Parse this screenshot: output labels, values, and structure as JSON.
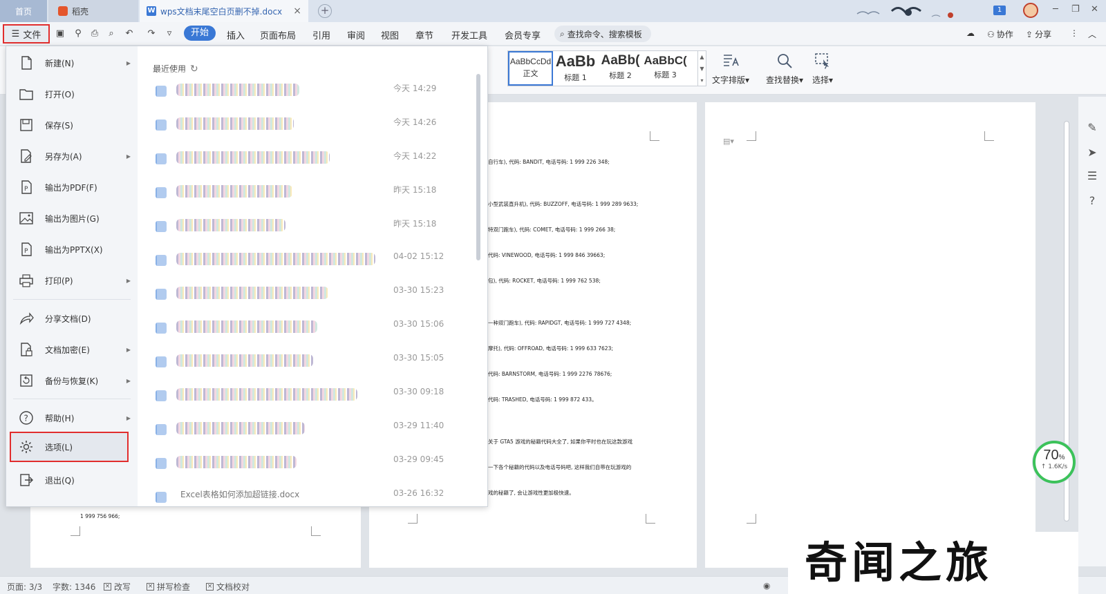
{
  "titlebar": {
    "home_tab": "首页",
    "docer_tab": "稻壳",
    "doc_tab": "wps文档末尾空白页删不掉.docx",
    "close_glyph": "×",
    "plus_glyph": "+",
    "badge": "1",
    "window_controls": [
      "─",
      "❐",
      "✕"
    ]
  },
  "menubar": {
    "file_label": "文件",
    "tabs": [
      "开始",
      "插入",
      "页面布局",
      "引用",
      "审阅",
      "视图",
      "章节",
      "开发工具",
      "会员专享"
    ],
    "active_tab": "开始",
    "search_placeholder": "查找命令、搜索模板",
    "collab_label": "协作",
    "share_label": "分享"
  },
  "ribbon": {
    "styles": [
      {
        "sample": "AaBbCcDd",
        "name": "正文"
      },
      {
        "sample": "AaBb",
        "name": "标题 1"
      },
      {
        "sample": "AaBb(",
        "name": "标题 2"
      },
      {
        "sample": "AaBbC(",
        "name": "标题 3"
      }
    ],
    "text_layout_label": "文字排版",
    "find_replace_label": "查找替换",
    "select_label": "选择"
  },
  "file_menu": {
    "items": [
      {
        "label": "新建(N)",
        "icon": "new-file-icon",
        "arrow": true
      },
      {
        "label": "打开(O)",
        "icon": "folder-icon",
        "arrow": false
      },
      {
        "label": "保存(S)",
        "icon": "save-icon",
        "arrow": false
      },
      {
        "label": "另存为(A)",
        "icon": "save-as-icon",
        "arrow": true
      },
      {
        "label": "输出为PDF(F)",
        "icon": "pdf-icon",
        "arrow": false
      },
      {
        "label": "输出为图片(G)",
        "icon": "image-icon",
        "arrow": false
      },
      {
        "label": "输出为PPTX(X)",
        "icon": "pptx-icon",
        "arrow": false
      },
      {
        "label": "打印(P)",
        "icon": "print-icon",
        "arrow": true
      },
      {
        "label": "分享文档(D)",
        "icon": "share-icon",
        "arrow": false
      },
      {
        "label": "文档加密(E)",
        "icon": "lock-icon",
        "arrow": true
      },
      {
        "label": "备份与恢复(K)",
        "icon": "backup-icon",
        "arrow": true
      },
      {
        "label": "帮助(H)",
        "icon": "help-icon",
        "arrow": true
      },
      {
        "label": "选项(L)",
        "icon": "gear-icon",
        "arrow": false
      },
      {
        "label": "退出(Q)",
        "icon": "exit-icon",
        "arrow": false
      }
    ],
    "recent_title": "最近使用",
    "recent_times": [
      "今天 14:29",
      "今天 14:26",
      "今天 14:22",
      "昨天 15:18",
      "昨天 15:18",
      "04-02 15:12",
      "03-30 15:23",
      "03-30 15:06",
      "03-30 15:05",
      "03-30 09:18",
      "03-29 11:40",
      "03-29 09:45",
      "03-26 16:32"
    ],
    "last_visible_file": "Excel表格如何添加超链接.docx"
  },
  "document": {
    "page2_lines": [
      "自行车), 代码: BANDIT, 电话号码: 1 999 226 348;",
      "",
      "小型武装直升机), 代码: BUZZOFF, 电话号码: 1 999 289 9633;",
      "特双门跑车), 代码: COMET, 电话号码: 1 999 266 38;",
      "代码: VINEWOOD, 电话号码: 1 999 846 39663;",
      "包), 代码: ROCKET, 电话号码: 1 999 762 538;",
      "",
      "一种双门跑车), 代码: RAPIDGT, 电话号码: 1 999 727 4348;",
      "摩托), 代码: OFFROAD, 电话号码: 1 999 633 7623;",
      "代码: BARNSTORM, 电话号码: 1 999 2276 78676;",
      "代码: TRASHED, 电话号码: 1 999 872 433。",
      "",
      "关于 GTA5 游戏的秘籍代码大全了, 如果你平时也在玩这款游戏",
      "一下各个秘籍的代码以及电话号码吧, 这样我们自带在玩游戏的",
      "戏的秘籍了, 会让游戏性更加极快速。"
    ],
    "page1_tail": "1 999 756 966;"
  },
  "speed": {
    "percent": "70",
    "unit": "%",
    "rate": "↑ 1.6K/s",
    "fill_fraction": 0.7
  },
  "statusbar": {
    "page": "页面: 3/3",
    "words": "字数: 1346",
    "revise": "改写",
    "spell": "拼写检查",
    "proof": "文档校对"
  },
  "watermark": "奇闻之旅"
}
